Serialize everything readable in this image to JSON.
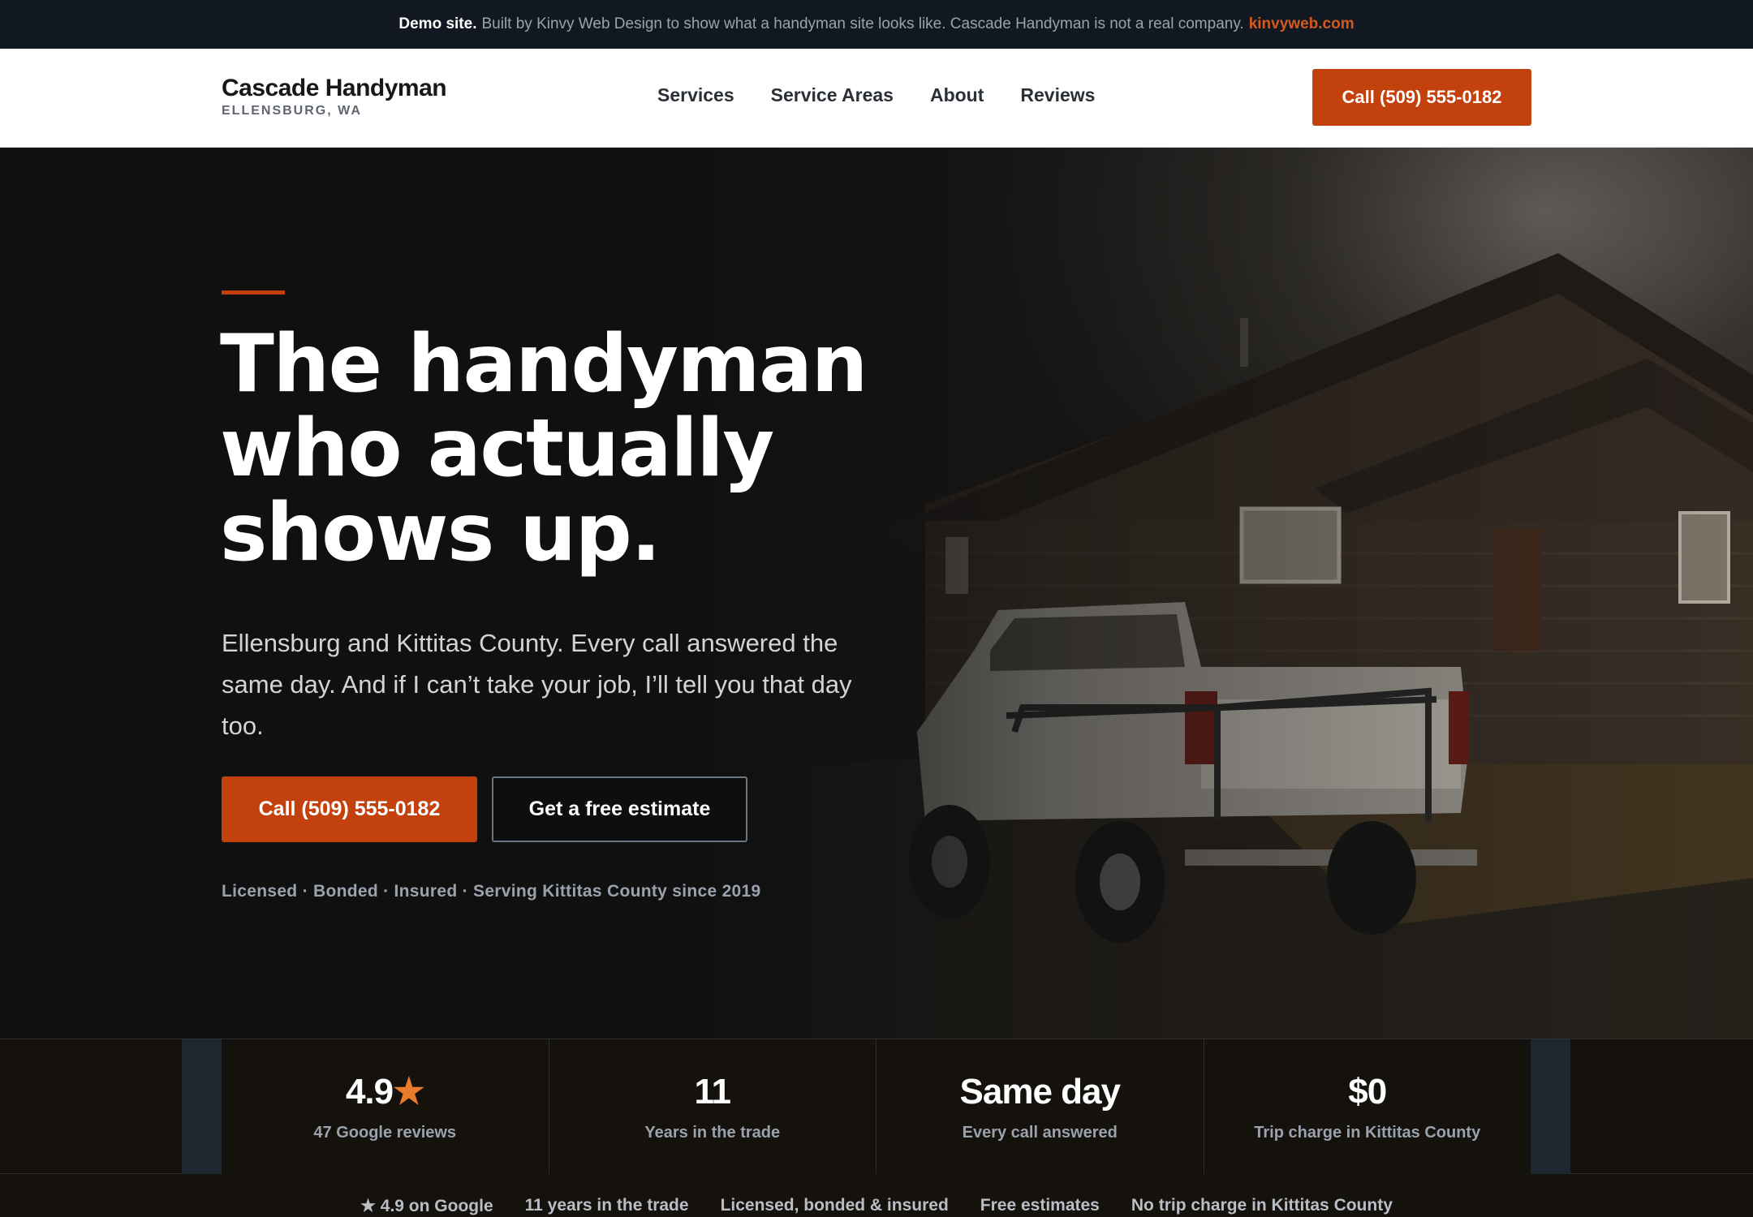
{
  "banner": {
    "bold": "Demo site.",
    "text": "Built by Kinvy Web Design to show what a handyman site looks like. Cascade Handyman is not a real company.",
    "link": "kinvyweb.com"
  },
  "header": {
    "brand_name": "Cascade Handyman",
    "brand_location": "ELLENSBURG, WA",
    "nav": [
      "Services",
      "Service Areas",
      "About",
      "Reviews"
    ],
    "cta": "Call (509) 555-0182"
  },
  "hero": {
    "headline_lines": [
      "The handyman",
      "who actually",
      "shows up."
    ],
    "subtext": "Ellensburg and Kittitas County. Every call answered the same day. And if I can’t take your job, I’ll tell you that day too.",
    "primary_button": "Call (509) 555-0182",
    "secondary_button": "Get a free estimate",
    "trust_line": "Licensed · Bonded · Insured · Serving Kittitas County since 2019"
  },
  "stats": [
    {
      "value": "4.9",
      "suffix": "★",
      "label": "47 Google reviews"
    },
    {
      "value": "11",
      "suffix": "",
      "label": "Years in the trade"
    },
    {
      "value": "Same day",
      "suffix": "",
      "label": "Every call answered"
    },
    {
      "value": "$0",
      "suffix": "",
      "label": "Trip charge in Kittitas County"
    }
  ],
  "ticker": [
    "★ 4.9 on Google",
    "11 years in the trade",
    "Licensed, bonded & insured",
    "Free estimates",
    "No trip charge in Kittitas County"
  ],
  "colors": {
    "accent": "#c2410c",
    "star": "#ea7a2c",
    "banner_bg": "#121821",
    "dark_bg": "#15110d"
  }
}
